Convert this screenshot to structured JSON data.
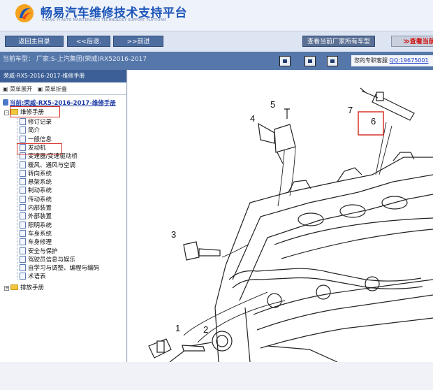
{
  "header": {
    "title": "畅易汽车维修技术支持平台",
    "subtitle": "CHANG YI AUTO MAINTENANCE TECHNOLOGY SUPPORT PLATFORM"
  },
  "toolbar": {
    "main_label": "返回主目录",
    "back_label": "<<后退.",
    "forward_label": ">>前进",
    "models_label": "查看当前厂家所有车型",
    "view_label": "≫查看当前"
  },
  "statusbar": {
    "model_text": "当前车型： 厂家:S-上汽集团(荣威)RX52016-2017",
    "chat_prefix": "您的专职客服 ",
    "chat_link": "QQ:19675001"
  },
  "sidebar": {
    "header": "荣威-RX5-2016-2017-维修手册",
    "expand_label": "菜单展开",
    "collapse_label": "菜单折叠",
    "root": "当前:荣威-RX5-2016-2017-维修手册",
    "manual": "维修手册",
    "items": [
      "修订记录",
      "简介",
      "一般信息",
      "发动机",
      "变速器/变速驱动桥",
      "暖风、通风与空调",
      "转向系统",
      "悬架系统",
      "制动系统",
      "传动系统",
      "内部装置",
      "外部装置",
      "照明系统",
      "车身系统",
      "车身修理",
      "安全与保护",
      "驾驶员信息与娱乐",
      "自学习与调整、编程与编码",
      "术语表"
    ],
    "other_manual": "排放手册"
  },
  "diagram": {
    "callouts": [
      "1",
      "2",
      "3",
      "4",
      "5",
      "6",
      "7"
    ]
  },
  "colors": {
    "title_blue": "#1d56b9",
    "statusbar_bg": "#5577a9",
    "highlight_red": "#d9332a"
  }
}
